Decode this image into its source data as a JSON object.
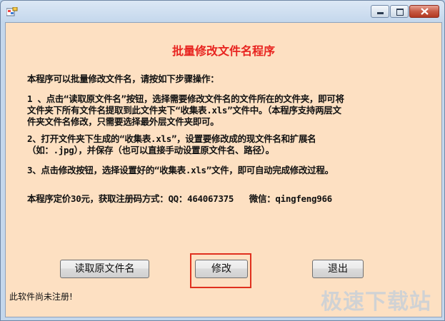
{
  "window": {
    "title_bar": {
      "min_icon": "minimize-icon",
      "max_icon": "maximize-icon",
      "close_icon": "close-icon"
    }
  },
  "main": {
    "heading": "批量修改文件名程序",
    "intro": "本程序可以批量修改文件名，请按如下步骤操作：",
    "step1_line1": "1 、点击“读取原文件名”按钮，选择需要修改文件名的文件所在的文件夹，即可将",
    "step1_line2": "文件夹下所有文件名提取到此文件夹下“收集表.xls”文件中。（本程序支持两层文",
    "step1_line3": "件夹文件名修改，只需要选择最外层文件夹即可。",
    "step2_line1": "2、打开文件夹下生成的“收集表.xls”，设置要修改成的现文件名和扩展名",
    "step2_line2": "（如：.jpg），并保存（也可以直接手动设置原文件名、路径）。",
    "step3": "3、点击修改按钮，选择设置好的“收集表.xls”文件，即可自动完成修改过程。",
    "price": "本程序定价30元，获取注册码方式：QQ：464067375   微信：qingfeng966"
  },
  "buttons": {
    "read": "读取原文件名",
    "modify": "修改",
    "exit": "退出"
  },
  "status": "此软件尚未注册!",
  "watermark": "极速下载站"
}
